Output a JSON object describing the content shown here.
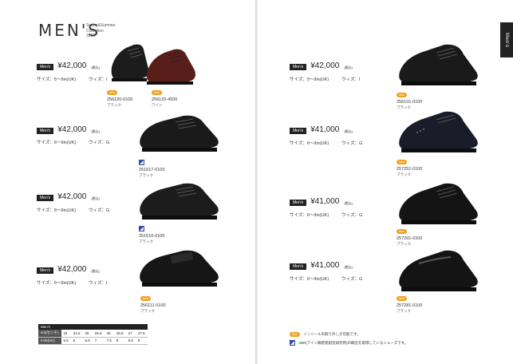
{
  "header": {
    "title": "MEN'S",
    "season_line1": "Spring&Summer",
    "season_line2": "Collection",
    "season_line3": "2019",
    "side_tab": "Men's"
  },
  "tag_label": "Men's",
  "tax_note": "(税込)",
  "left": [
    {
      "price": "¥42,000",
      "size": "サイズ：5〜9in(UK)",
      "width": "ウィズ：I",
      "items": [
        {
          "code": "256120-0100",
          "color": "ブラック"
        },
        {
          "code": "256120-4500",
          "color": "ワイン"
        }
      ]
    },
    {
      "price": "¥42,000",
      "size": "サイズ：6〜9in(UK)",
      "width": "ウィズ：G",
      "items": [
        {
          "code": "251617-0100",
          "color": "ブラック"
        }
      ]
    },
    {
      "price": "¥42,000",
      "size": "サイズ：6〜9in(UK)",
      "width": "ウィズ：G",
      "items": [
        {
          "code": "251610-0100",
          "color": "ブラック"
        }
      ]
    },
    {
      "price": "¥42,000",
      "size": "サイズ：5〜9in(UK)",
      "width": "ウィズ：I",
      "items": [
        {
          "code": "256111-0100",
          "color": "ブラック"
        }
      ]
    }
  ],
  "right": [
    {
      "price": "¥42,000",
      "size": "サイズ：5〜9in(UK)",
      "width": "ウィズ：I",
      "items": [
        {
          "code": "256101-0100",
          "color": "ブラック"
        }
      ]
    },
    {
      "price": "¥41,000",
      "size": "サイズ：6〜9in(UK)",
      "width": "ウィズ：G",
      "items": [
        {
          "code": "257251-0100",
          "color": "ブラック"
        }
      ]
    },
    {
      "price": "¥41,000",
      "size": "サイズ：6〜9in(UK)",
      "width": "ウィズ：G",
      "items": [
        {
          "code": "257201-0100",
          "color": "ブラック"
        }
      ]
    },
    {
      "price": "¥41,000",
      "size": "サイズ：6〜9in(UK)",
      "width": "ウィズ：G",
      "items": [
        {
          "code": "257281-0100",
          "color": "ブラック"
        }
      ]
    }
  ],
  "badges": {
    "new": "New"
  },
  "size_table": {
    "header": "Men's",
    "rows": [
      {
        "label": "cm(センチ)",
        "values": [
          "24",
          "24.5",
          "25",
          "25.5",
          "26",
          "26.5",
          "27",
          "27.5"
        ]
      },
      {
        "label": "Inch(UK)",
        "values": [
          "5.5",
          "6",
          "6.5",
          "7",
          "7.5",
          "8",
          "8.5",
          "9"
        ]
      }
    ]
  },
  "notes": [
    "インソールの取り外しが可能です。",
    "ABR(アイン脚感覚創造研究所)の概念を取得しているシューズです。"
  ]
}
